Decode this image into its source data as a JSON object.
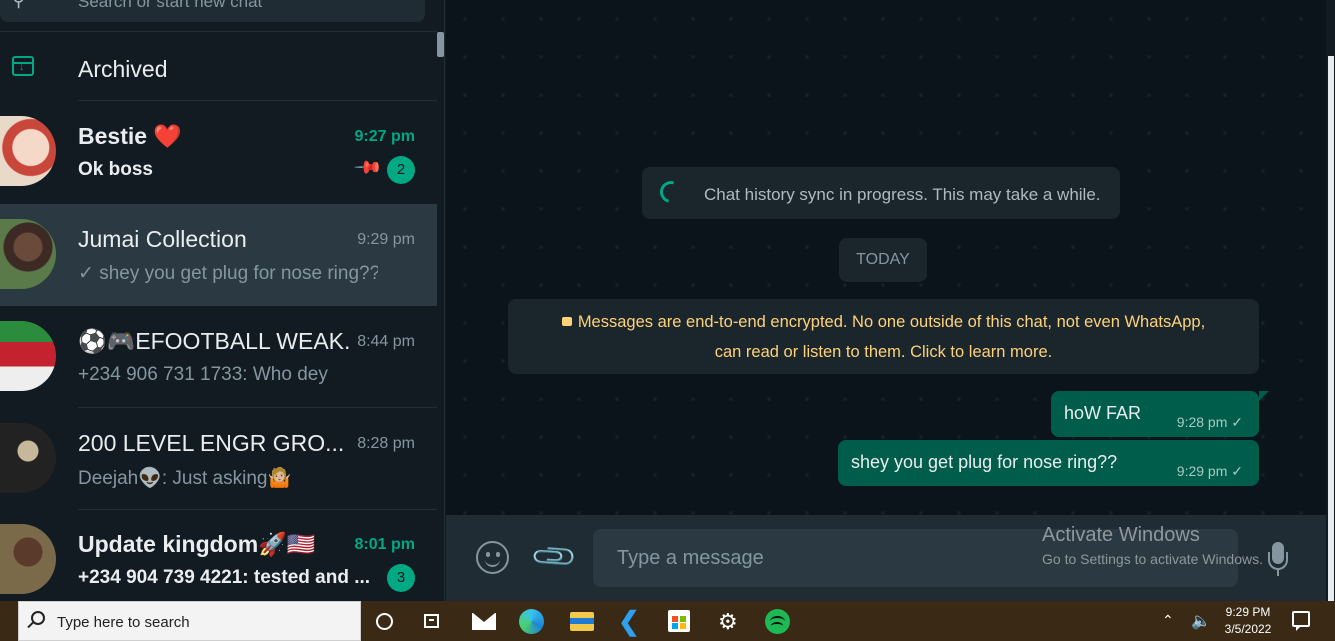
{
  "sidebar": {
    "search_placeholder": "Search or start new chat",
    "archived_label": "Archived",
    "chats": [
      {
        "name": "Bestie ❤️",
        "time": "9:27 pm",
        "preview": "Ok boss",
        "unread": "2",
        "pinned": true
      },
      {
        "name": "Jumai Collection",
        "time": "9:29 pm",
        "preview": "✓ shey you get plug for nose ring??",
        "active": true
      },
      {
        "name": "⚽🎮EFOOTBALL WEAK...",
        "time": "8:44 pm",
        "preview": "+234 906 731 1733: Who dey"
      },
      {
        "name": "200 LEVEL  ENGR GRO...",
        "time": "8:28 pm",
        "preview": "Deejah👽: Just asking🤷🏼"
      },
      {
        "name": "Update kingdom🚀🇺🇸",
        "time": "8:01 pm",
        "preview": "+234 904 739 4221: tested and ...",
        "unread": "3"
      }
    ]
  },
  "conversation": {
    "sync_text": "Chat history sync in progress. This may take a while.",
    "date_label": "TODAY",
    "encryption_notice_line1": "Messages are end-to-end encrypted. No one outside of this chat, not even WhatsApp,",
    "encryption_notice_line2": "can read or listen to them. Click to learn more.",
    "messages": [
      {
        "text": "hoW FAR",
        "time": "9:28 pm ✓"
      },
      {
        "text": "shey you get plug for nose ring??",
        "time": "9:29 pm ✓"
      }
    ]
  },
  "composer": {
    "placeholder": "Type a message"
  },
  "watermark": {
    "line1": "Activate Windows",
    "line2": "Go to Settings to activate Windows."
  },
  "taskbar": {
    "search_placeholder": "Type here to search",
    "time": "9:29 PM",
    "date": "3/5/2022"
  },
  "colors": {
    "accent": "#00a884",
    "outgoing_bubble": "#005c4b",
    "panel": "#111b21",
    "notice_text": "#ffd279"
  }
}
